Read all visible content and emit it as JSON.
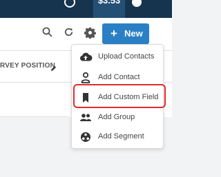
{
  "topbar": {
    "balance": "$3.53"
  },
  "toolbar": {
    "new_label": "New"
  },
  "table": {
    "column_label": "RVEY POSITION"
  },
  "menu": {
    "items": [
      {
        "label": "Upload Contacts",
        "icon": "cloud-upload-icon"
      },
      {
        "label": "Add Contact",
        "icon": "person-icon"
      },
      {
        "label": "Add Custom Field",
        "icon": "bookmark-icon"
      },
      {
        "label": "Add Group",
        "icon": "group-icon"
      },
      {
        "label": "Add Segment",
        "icon": "segment-icon"
      }
    ],
    "highlighted_item": "Add Custom Field"
  },
  "colors": {
    "topbar": "#17344f",
    "balance_bg": "#255075",
    "primary_button": "#2b80c5",
    "highlight_border": "#e22b2b"
  }
}
